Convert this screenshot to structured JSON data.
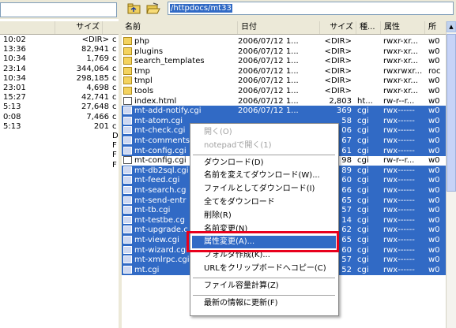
{
  "left_pane": {
    "header": [
      "",
      "サイズ"
    ],
    "rows": [
      {
        "time": "10:02",
        "size": "<DIR>"
      },
      {
        "time": "13:36",
        "size": "82,941"
      },
      {
        "time": "10:34",
        "size": "1,769"
      },
      {
        "time": "23:14",
        "size": "344,064"
      },
      {
        "time": "10:34",
        "size": "298,185"
      },
      {
        "time": "23:01",
        "size": "4,698"
      },
      {
        "time": "15:27",
        "size": "42,741"
      },
      {
        "time": "5:13",
        "size": "27,648"
      },
      {
        "time": "0:08",
        "size": "7,466"
      },
      {
        "time": "5:13",
        "size": "201"
      }
    ],
    "right_edge_letters": [
      "c",
      "c",
      "c",
      "c",
      "c",
      "c",
      "c",
      "c",
      "c",
      "c",
      "D",
      "F",
      "F",
      "F"
    ]
  },
  "toolbar": {
    "address": "/httpdocs/mt33",
    "up_icon": "folder-up-icon",
    "open_icon": "folder-open-icon"
  },
  "right_pane": {
    "headers": {
      "name": "名前",
      "date": "日付",
      "size": "サイズ",
      "kind": "種...",
      "attr": "属性",
      "owner": "所"
    },
    "rows": [
      {
        "icon": "folder",
        "name": "php",
        "date": "2006/07/12 1...",
        "size": "<DIR>",
        "kind": "",
        "attr": "rwxr-xr...",
        "owner": "w0",
        "selected": false
      },
      {
        "icon": "folder",
        "name": "plugins",
        "date": "2006/07/12 1...",
        "size": "<DIR>",
        "kind": "",
        "attr": "rwxr-xr...",
        "owner": "w0",
        "selected": false
      },
      {
        "icon": "folder",
        "name": "search_templates",
        "date": "2006/07/12 1...",
        "size": "<DIR>",
        "kind": "",
        "attr": "rwxr-xr...",
        "owner": "w0",
        "selected": false
      },
      {
        "icon": "folder",
        "name": "tmp",
        "date": "2006/07/12 1...",
        "size": "<DIR>",
        "kind": "",
        "attr": "rwxrwxr...",
        "owner": "roc",
        "selected": false
      },
      {
        "icon": "folder",
        "name": "tmpl",
        "date": "2006/07/12 1...",
        "size": "<DIR>",
        "kind": "",
        "attr": "rwxr-xr...",
        "owner": "w0",
        "selected": false
      },
      {
        "icon": "folder",
        "name": "tools",
        "date": "2006/07/12 1...",
        "size": "<DIR>",
        "kind": "",
        "attr": "rwxr-xr...",
        "owner": "w0",
        "selected": false
      },
      {
        "icon": "doc",
        "name": "index.html",
        "date": "2006/07/12 1...",
        "size": "2,803",
        "kind": "ht...",
        "attr": "rw-r--r...",
        "owner": "w0",
        "selected": false
      },
      {
        "icon": "doc",
        "name": "mt-add-notify.cgi",
        "date": "2006/07/12 1...",
        "size": "369",
        "kind": "cgi",
        "attr": "rwx------",
        "owner": "w0",
        "selected": true
      },
      {
        "icon": "doc",
        "name": "mt-atom.cgi",
        "date": "",
        "size": "58",
        "kind": "cgi",
        "attr": "rwx------",
        "owner": "w0",
        "selected": true
      },
      {
        "icon": "doc",
        "name": "mt-check.cgi",
        "date": "",
        "size": "06",
        "kind": "cgi",
        "attr": "rwx------",
        "owner": "w0",
        "selected": true
      },
      {
        "icon": "doc",
        "name": "mt-comments",
        "date": "",
        "size": "67",
        "kind": "cgi",
        "attr": "rwx------",
        "owner": "w0",
        "selected": true
      },
      {
        "icon": "doc",
        "name": "mt-config.cgi",
        "date": "",
        "size": "61",
        "kind": "cgi",
        "attr": "rwx------",
        "owner": "w0",
        "selected": true
      },
      {
        "icon": "doc",
        "name": "mt-config.cgi",
        "date": "",
        "size": "98",
        "kind": "cgi",
        "attr": "rw-r--r...",
        "owner": "w0",
        "selected": false
      },
      {
        "icon": "doc",
        "name": "mt-db2sql.cgi",
        "date": "",
        "size": "89",
        "kind": "cgi",
        "attr": "rwx------",
        "owner": "w0",
        "selected": true
      },
      {
        "icon": "doc",
        "name": "mt-feed.cgi",
        "date": "",
        "size": "60",
        "kind": "cgi",
        "attr": "rwx------",
        "owner": "w0",
        "selected": true
      },
      {
        "icon": "doc",
        "name": "mt-search.cg",
        "date": "",
        "size": "66",
        "kind": "cgi",
        "attr": "rwx------",
        "owner": "w0",
        "selected": true
      },
      {
        "icon": "doc",
        "name": "mt-send-entr",
        "date": "",
        "size": "65",
        "kind": "cgi",
        "attr": "rwx------",
        "owner": "w0",
        "selected": true
      },
      {
        "icon": "doc",
        "name": "mt-tb.cgi",
        "date": "",
        "size": "57",
        "kind": "cgi",
        "attr": "rwx------",
        "owner": "w0",
        "selected": true
      },
      {
        "icon": "doc",
        "name": "mt-testbe.cg",
        "date": "",
        "size": "14",
        "kind": "cgi",
        "attr": "rwx------",
        "owner": "w0",
        "selected": true
      },
      {
        "icon": "doc",
        "name": "mt-upgrade.c",
        "date": "",
        "size": "62",
        "kind": "cgi",
        "attr": "rwx------",
        "owner": "w0",
        "selected": true
      },
      {
        "icon": "doc",
        "name": "mt-view.cgi",
        "date": "",
        "size": "65",
        "kind": "cgi",
        "attr": "rwx------",
        "owner": "w0",
        "selected": true
      },
      {
        "icon": "doc",
        "name": "mt-wizard.cgi",
        "date": "",
        "size": "60",
        "kind": "cgi",
        "attr": "rwx------",
        "owner": "w0",
        "selected": true
      },
      {
        "icon": "doc",
        "name": "mt-xmlrpc.cgi",
        "date": "",
        "size": "57",
        "kind": "cgi",
        "attr": "rwx------",
        "owner": "w0",
        "selected": true
      },
      {
        "icon": "doc",
        "name": "mt.cgi",
        "date": "",
        "size": "52",
        "kind": "cgi",
        "attr": "rwx------",
        "owner": "w0",
        "selected": true
      }
    ]
  },
  "context_menu": {
    "items": [
      {
        "label": "開く(O)",
        "disabled": true
      },
      {
        "label": "notepadで開く(1)",
        "disabled": true
      },
      {
        "sep": true
      },
      {
        "label": "ダウンロード(D)"
      },
      {
        "label": "名前を変えてダウンロード(W)..."
      },
      {
        "label": "ファイルとしてダウンロード(I)"
      },
      {
        "label": "全てをダウンロード"
      },
      {
        "label": "削除(R)"
      },
      {
        "label": "名前変更(N)"
      },
      {
        "label": "属性変更(A)...",
        "highlighted": true
      },
      {
        "label": "フォルダ作成(K)..."
      },
      {
        "label": "URLをクリップボードへコピー(C)"
      },
      {
        "sep": true
      },
      {
        "label": "ファイル容量計算(Z)"
      },
      {
        "sep": true
      },
      {
        "label": "最新の情報に更新(F)"
      }
    ]
  },
  "colors": {
    "selection": "#316ac5",
    "highlight_box": "#e8001c"
  }
}
